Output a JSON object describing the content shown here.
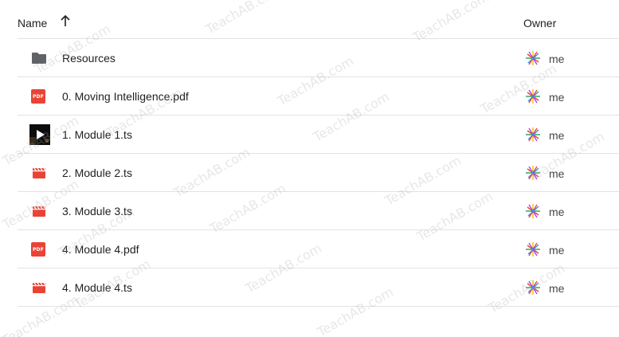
{
  "header": {
    "name_label": "Name",
    "owner_label": "Owner",
    "sort_direction": "ascending"
  },
  "files": [
    {
      "name": "Resources",
      "type": "folder",
      "icon": "folder-icon",
      "owner": "me"
    },
    {
      "name": "0. Moving Intelligence.pdf",
      "type": "pdf",
      "icon": "pdf-icon",
      "icon_text": "PDF",
      "owner": "me"
    },
    {
      "name": "1. Module 1.ts",
      "type": "video-thumbnail",
      "icon": "video-thumbnail",
      "owner": "me"
    },
    {
      "name": "2. Module 2.ts",
      "type": "video",
      "icon": "video-icon",
      "owner": "me"
    },
    {
      "name": "3. Module 3.ts",
      "type": "video",
      "icon": "video-icon",
      "owner": "me"
    },
    {
      "name": "4. Module 4.pdf",
      "type": "pdf",
      "icon": "pdf-icon",
      "icon_text": "PDF",
      "owner": "me"
    },
    {
      "name": "4. Module 4.ts",
      "type": "video",
      "icon": "video-icon",
      "owner": "me"
    }
  ],
  "watermark": "TeachAB.com",
  "colors": {
    "pdf_red": "#ea4335",
    "video_red": "#ea4335",
    "folder_gray": "#5f6368",
    "divider": "#e1e3e1"
  }
}
